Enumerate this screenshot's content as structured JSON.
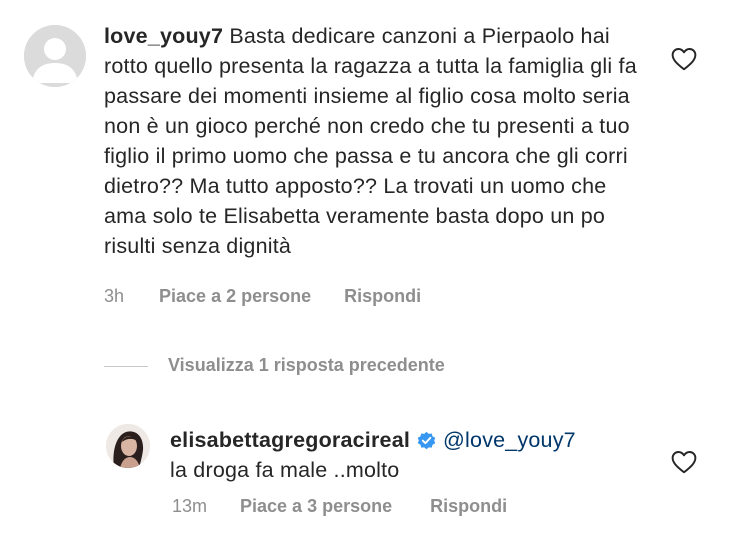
{
  "comment": {
    "username": "love_youy7",
    "text": "Basta dedicare canzoni a Pierpaolo hai rotto quello presenta la ragazza a tutta la famiglia gli fa passare dei momenti insieme al figlio cosa molto seria non è un gioco perché non credo che tu presenti a tuo figlio il primo uomo che passa e tu ancora che gli corri dietro?? Ma tutto apposto?? La trovati un uomo che ama solo te Elisabetta veramente basta dopo un po risulti senza dignità",
    "time": "3h",
    "likes": "Piace a 2 persone",
    "reply_label": "Rispondi"
  },
  "view_replies": "Visualizza 1 risposta precedente",
  "reply": {
    "username": "elisabettagregoracireal",
    "mention": "@love_youy7",
    "text": "la droga fa male ..molto",
    "time": "13m",
    "likes": "Piace a 3 persone",
    "reply_label": "Rispondi"
  },
  "icons": {
    "heart": "heart-outline-icon",
    "verified": "verified-badge-icon"
  },
  "colors": {
    "text": "#262626",
    "secondary": "#8e8e8e",
    "verified": "#3897f0",
    "mention": "#00376b"
  }
}
